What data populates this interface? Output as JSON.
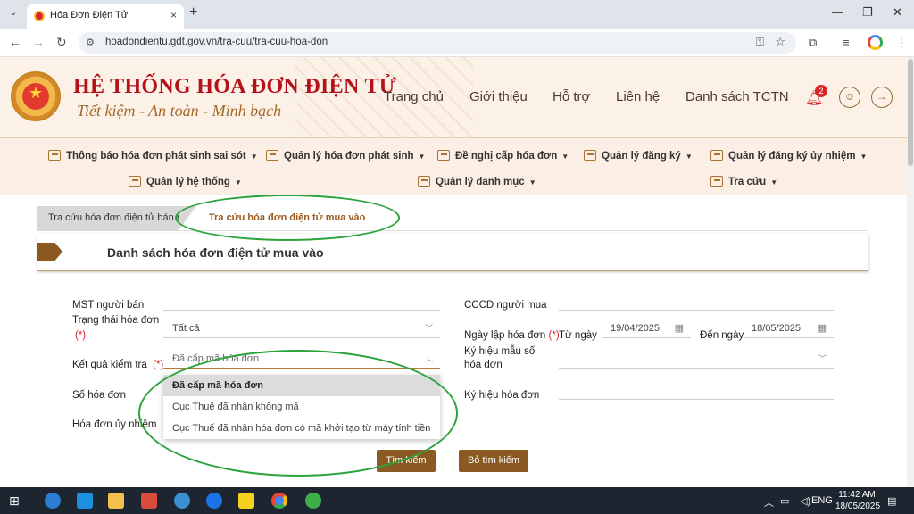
{
  "browser": {
    "tab_title": "Hóa Đơn Điện Tử",
    "tab_close": "×",
    "new_tab": "+",
    "tab_dropdown": "⌄",
    "url": "hoadondientu.gdt.gov.vn/tra-cuu/tra-cuu-hoa-don",
    "back": "←",
    "forward": "→",
    "reload": "↻",
    "minimize": "—",
    "maximize": "❐",
    "close": "✕"
  },
  "header": {
    "title": "HỆ THỐNG HÓA ĐƠN ĐIỆN TỬ",
    "slogan": "Tiết kiệm - An toàn - Minh bạch",
    "nav": [
      "Trang chủ",
      "Giới thiệu",
      "Hỗ trợ",
      "Liên hệ",
      "Danh sách TCTN"
    ],
    "notification_count": "2"
  },
  "menu": {
    "row1": [
      "Thông báo hóa đơn phát sinh sai sót",
      "Quản lý hóa đơn phát sinh",
      "Đề nghị cấp hóa đơn",
      "Quản lý đăng ký",
      "Quản lý đăng ký ủy nhiệm"
    ],
    "row2": [
      "Quản lý hệ thống",
      "Quản lý danh mục",
      "Tra cứu"
    ]
  },
  "tabs": {
    "sold": "Tra cứu hóa đơn điện tử bán ra",
    "purchased": "Tra cứu hóa đơn điện tử mua vào"
  },
  "list_title": "Danh sách hóa đơn điện tử mua vào",
  "form": {
    "seller_tax_code": "MST người bán",
    "buyer_id": "CCCD người mua",
    "invoice_status": "Trạng thái hóa đơn",
    "invoice_status_value": "Tất cả",
    "required_mark": "(*)",
    "invoice_date": "Ngày lập hóa đơn",
    "from_date_label": "Từ ngày",
    "from_date": "19/04/2025",
    "to_date_label": "Đến ngày",
    "to_date": "18/05/2025",
    "check_result": "Kết quả kiểm tra",
    "check_result_value": "Đã cấp mã hóa đơn",
    "template_symbol": "Ký hiệu mẫu số hóa đơn",
    "invoice_number": "Số hóa đơn",
    "invoice_symbol": "Ký hiệu hóa đơn",
    "authorized_invoice": "Hóa đơn ủy nhiệm"
  },
  "dropdown_options": [
    "Đã cấp mã hóa đơn",
    "Cục Thuế đã nhận không mã",
    "Cục Thuế đã nhận hóa đơn có mã khởi tạo từ máy tính tiền"
  ],
  "buttons": {
    "search": "Tìm kiếm",
    "clear": "Bỏ tìm kiếm"
  },
  "taskbar": {
    "lang": "ENG",
    "time": "11:42 AM",
    "date": "18/05/2025"
  }
}
